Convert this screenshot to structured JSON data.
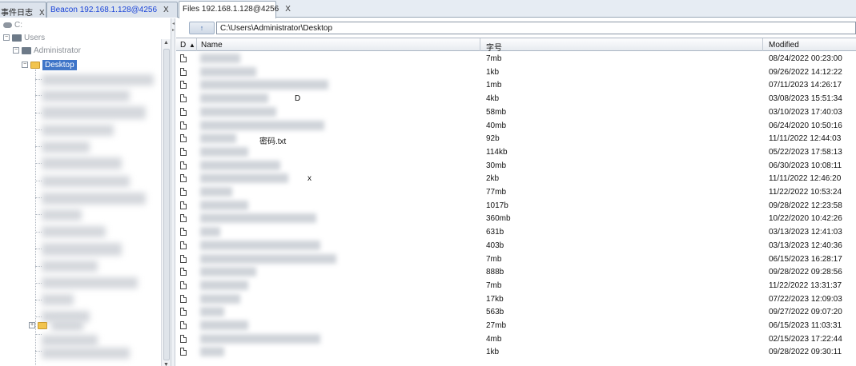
{
  "tabs": [
    {
      "label": "事件日志",
      "close": "X"
    },
    {
      "label": "Beacon 192.168.1.128@4256",
      "close": "X"
    },
    {
      "label": "Files 192.168.1.128@4256",
      "close": "X"
    }
  ],
  "tree": {
    "drive": "C:",
    "users": "Users",
    "administrator": "Administrator",
    "selected": "Desktop"
  },
  "path_bar": {
    "up_button_label": "↑",
    "path": "C:\\Users\\Administrator\\Desktop"
  },
  "table": {
    "columns": {
      "type": "D",
      "sort_indicator": "▲",
      "name": "Name",
      "size": "字号",
      "modified": "Modified"
    },
    "rows": [
      {
        "name_suffix": "",
        "size": "7mb",
        "modified": "08/24/2022 00:23:00"
      },
      {
        "name_suffix": "",
        "size": "1kb",
        "modified": "09/26/2022 14:12:22"
      },
      {
        "name_suffix": "",
        "size": "1mb",
        "modified": "07/11/2023 14:26:17"
      },
      {
        "name_suffix": "D",
        "size": "4kb",
        "modified": "03/08/2023 15:51:34"
      },
      {
        "name_suffix": "",
        "size": "58mb",
        "modified": "03/10/2023 17:40:03"
      },
      {
        "name_suffix": "",
        "size": "40mb",
        "modified": "06/24/2020 10:50:16"
      },
      {
        "name_suffix": "密码.txt",
        "size": "92b",
        "modified": "11/11/2022 12:44:03"
      },
      {
        "name_suffix": "",
        "size": "114kb",
        "modified": "05/22/2023 17:58:13"
      },
      {
        "name_suffix": "",
        "size": "30mb",
        "modified": "06/30/2023 10:08:11"
      },
      {
        "name_suffix": "x",
        "size": "2kb",
        "modified": "11/11/2022 12:46:20"
      },
      {
        "name_suffix": "",
        "size": "77mb",
        "modified": "11/22/2022 10:53:24"
      },
      {
        "name_suffix": "",
        "size": "1017b",
        "modified": "09/28/2022 12:23:58"
      },
      {
        "name_suffix": "",
        "size": "360mb",
        "modified": "10/22/2020 10:42:26"
      },
      {
        "name_suffix": "",
        "size": "631b",
        "modified": "03/13/2023 12:41:03"
      },
      {
        "name_suffix": "",
        "size": "403b",
        "modified": "03/13/2023 12:40:36"
      },
      {
        "name_suffix": "",
        "size": "7mb",
        "modified": "06/15/2023 16:28:17"
      },
      {
        "name_suffix": "",
        "size": "888b",
        "modified": "09/28/2022 09:28:56"
      },
      {
        "name_suffix": "",
        "size": "7mb",
        "modified": "11/22/2022 13:31:37"
      },
      {
        "name_suffix": "",
        "size": "17kb",
        "modified": "07/22/2023 12:09:03"
      },
      {
        "name_suffix": "",
        "size": "563b",
        "modified": "09/27/2022 09:07:20"
      },
      {
        "name_suffix": "",
        "size": "27mb",
        "modified": "06/15/2023 11:03:31"
      },
      {
        "name_suffix": "",
        "size": "4mb",
        "modified": "02/15/2023 17:22:44"
      },
      {
        "name_suffix": "",
        "size": "1kb",
        "modified": "09/28/2022 09:30:11"
      }
    ]
  }
}
